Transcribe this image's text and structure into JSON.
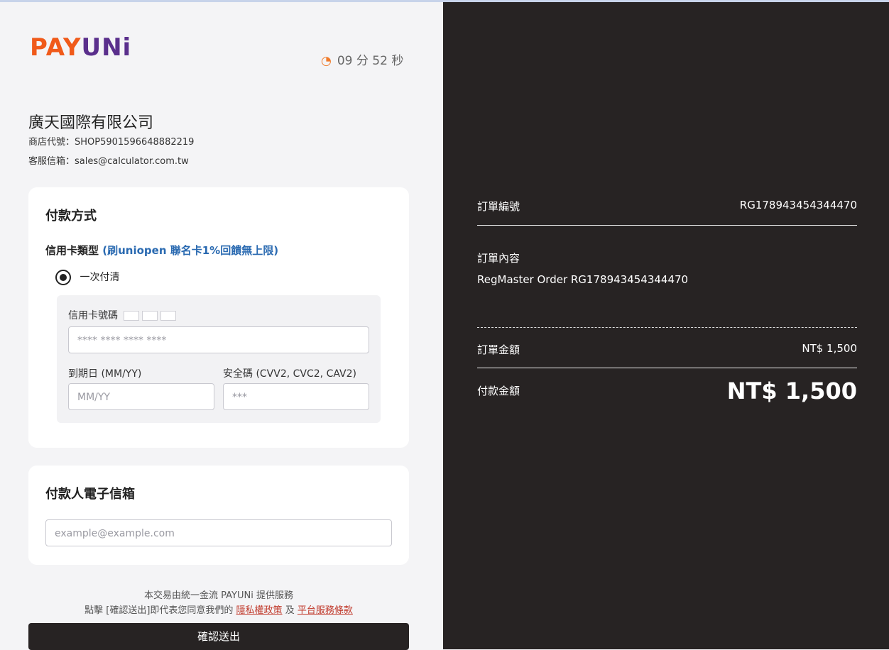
{
  "brand": {
    "pay": "PAY",
    "uni": "UNi"
  },
  "timer": "09 分 52 秒",
  "merchant": {
    "name": "廣天國際有限公司",
    "shop": "商店代號：SHOP5901596648882219",
    "email": "客服信箱：sales@calculator.com.tw"
  },
  "payment": {
    "title": "付款方式",
    "card_type": "信用卡類型",
    "promo": "(刷uniopen 聯名卡1%回饋無上限)",
    "option": "一次付清",
    "card_label": "信用卡號碼",
    "card_placeholder": "**** **** **** ****",
    "expiry_label": "到期日 (MM/YY)",
    "expiry_placeholder": "MM/YY",
    "cvv_label": "安全碼 (CVV2, CVC2, CAV2)",
    "cvv_placeholder": "***"
  },
  "email_section": {
    "title": "付款人電子信箱",
    "placeholder": "example@example.com"
  },
  "footer": {
    "line1": "本交易由統一金流 PAYUNi 提供服務",
    "prefix": "點擊 [確認送出]即代表您同意我們的",
    "privacy": "隱私權政策",
    "and": "及",
    "terms": "平台服務條款",
    "submit": "確認送出"
  },
  "order": {
    "number_label": "訂單編號",
    "number": "RG178943454344470",
    "content_label": "訂單內容",
    "content": "RegMaster Order RG178943454344470",
    "amount_label": "訂單金額",
    "amount": "NT$ 1,500",
    "pay_label": "付款金額",
    "pay_amount": "NT$ 1,500"
  }
}
